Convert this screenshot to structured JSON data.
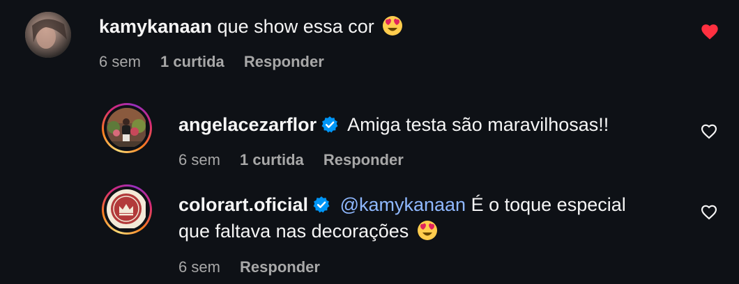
{
  "comments": [
    {
      "username": "kamykanaan",
      "text": "que show essa cor",
      "emoji": "heart-eyes-emoji",
      "time": "6 sem",
      "likes": "1 curtida",
      "reply": "Responder",
      "liked": true
    },
    {
      "username": "angelacezarflor",
      "verified": true,
      "text": "Amiga testa são maravilhosas!!",
      "time": "6 sem",
      "likes": "1 curtida",
      "reply": "Responder",
      "liked": false
    },
    {
      "username": "colorart.oficial",
      "verified": true,
      "mention": "@kamykanaan",
      "text_line1": "É o toque especial",
      "text_line2": "que faltava nas decorações",
      "emoji": "heart-eyes-emoji",
      "time": "6 sem",
      "reply": "Responder",
      "liked": false
    }
  ],
  "colors": {
    "background": "#0e1116",
    "like_red": "#ff3040",
    "mention_blue": "#8fb8ff",
    "verified_blue": "#0095f6",
    "meta_gray": "#a8a8a8"
  }
}
